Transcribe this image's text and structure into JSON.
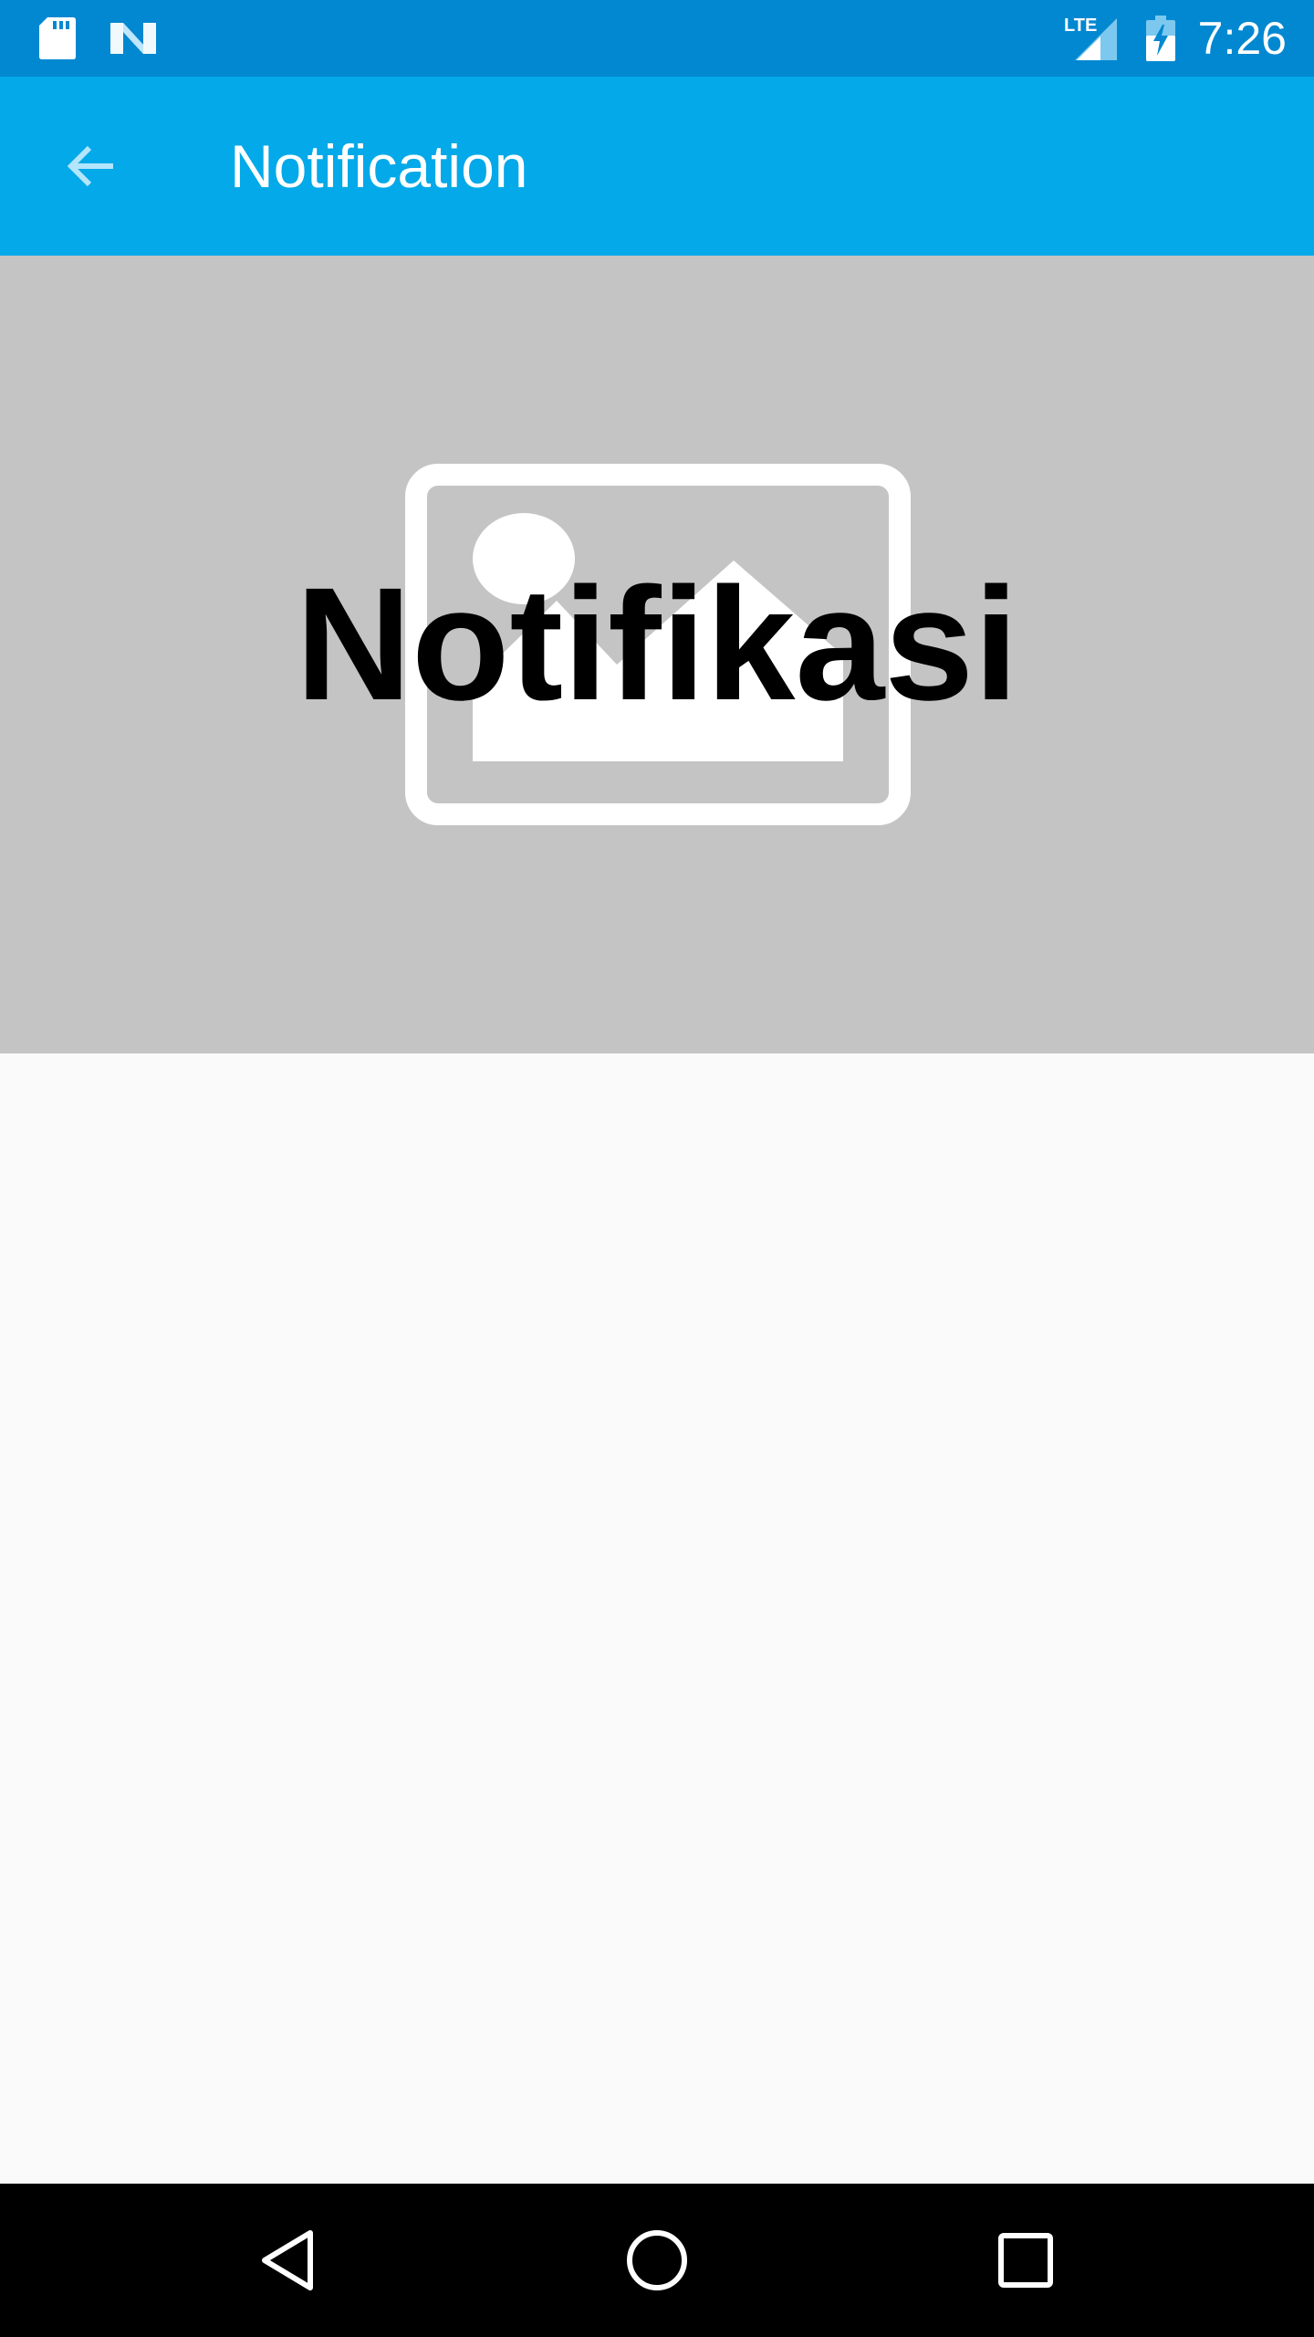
{
  "status_bar": {
    "time": "7:26",
    "network": "LTE",
    "icons": [
      "sd-card-icon",
      "n-logo-icon",
      "lte-signal-icon",
      "battery-charging-icon"
    ]
  },
  "app_bar": {
    "title": "Notification",
    "back_icon": "arrow-back-icon"
  },
  "banner": {
    "title": "Notifikasi",
    "placeholder_icon": "image-placeholder-icon"
  },
  "nav_bar": {
    "buttons": [
      "back-triangle-icon",
      "home-circle-icon",
      "recents-square-icon"
    ]
  },
  "colors": {
    "status_bar": "#0288d1",
    "app_bar": "#03a9e9",
    "banner_bg": "#c4c4c4",
    "background": "#fafafa",
    "nav_bar": "#000000"
  }
}
